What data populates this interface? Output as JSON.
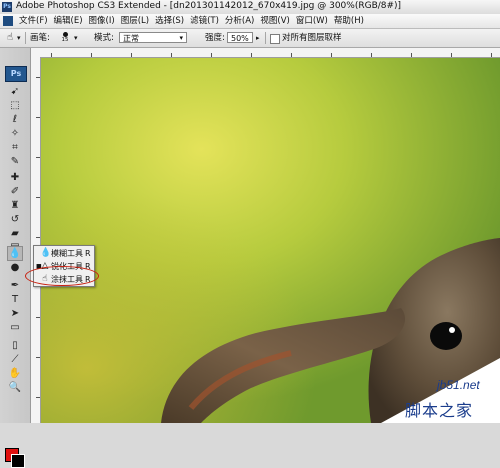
{
  "titlebar": {
    "app_icon": "Ps",
    "title": "Adobe Photoshop CS3 Extended - [dn201301142012_670x419.jpg @ 300%(RGB/8#)]"
  },
  "menubar": {
    "items": [
      "文件(F)",
      "编辑(E)",
      "图像(I)",
      "图层(L)",
      "选择(S)",
      "滤镜(T)",
      "分析(A)",
      "视图(V)",
      "窗口(W)",
      "帮助(H)"
    ]
  },
  "options": {
    "brush_label": "画笔:",
    "brush_size": "15",
    "mode_label": "模式:",
    "mode_value": "正常",
    "strength_label": "强度:",
    "strength_value": "50%",
    "sample_all_layers": "对所有图层取样"
  },
  "toolbox": {
    "logo": "Ps",
    "tools": [
      "move-icon",
      "marquee-icon",
      "lasso-icon",
      "magic-wand-icon",
      "crop-icon",
      "slice-icon",
      "healing-icon",
      "brush-icon",
      "clone-stamp-icon",
      "history-brush-icon",
      "eraser-icon",
      "gradient-icon",
      "blur-icon",
      "dodge-icon",
      "pen-icon",
      "type-icon",
      "path-select-icon",
      "shape-icon",
      "notes-icon",
      "eyedropper-icon",
      "hand-icon",
      "zoom-icon"
    ],
    "foreground_color": "#e0100f",
    "background_color": "#000000"
  },
  "flyout": {
    "items": [
      {
        "icon": "drop-icon",
        "label": "模糊工具",
        "key": "R"
      },
      {
        "icon": "sharpen-icon",
        "label": "锐化工具",
        "key": "R"
      },
      {
        "icon": "smudge-icon",
        "label": "涂抹工具",
        "key": "R"
      }
    ]
  },
  "watermark": {
    "site": "jb51.net",
    "name": "脚本之家"
  }
}
